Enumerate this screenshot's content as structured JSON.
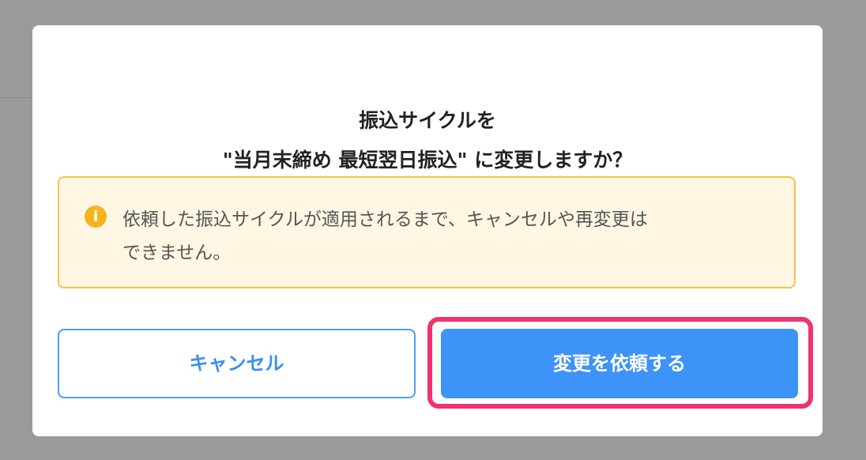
{
  "dialog": {
    "title_line1": "振込サイクルを",
    "title_line2": "\"当月末締め 最短翌日振込\" に変更しますか？"
  },
  "notice": {
    "icon": "info-icon",
    "icon_glyph": "i",
    "text_line1": "依頼した振込サイクルが適用されるまで、キャンセルや再変更は",
    "text_line2": "できません。"
  },
  "buttons": {
    "cancel_label": "キャンセル",
    "confirm_label": "変更を依頼する"
  },
  "colors": {
    "primary": "#3d93f8",
    "notice_background": "#fff6e4",
    "notice_border": "#f6c34a",
    "highlight": "#f0326e"
  }
}
